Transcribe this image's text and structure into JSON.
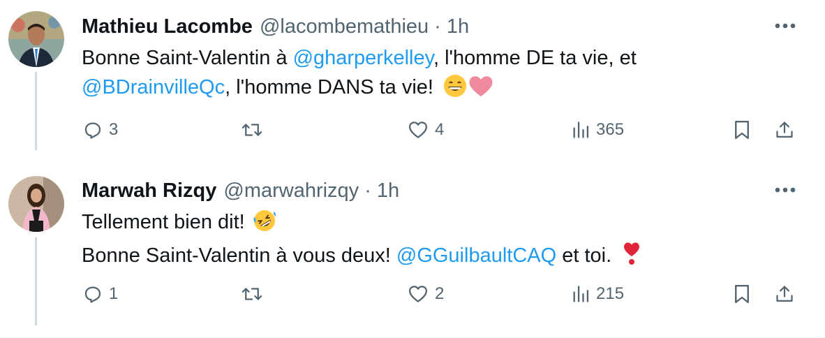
{
  "tweets": [
    {
      "name": "Mathieu Lacombe",
      "handle": "@lacombemathieu",
      "separator": "·",
      "time": "1h",
      "text_1a": "Bonne Saint-Valentin à ",
      "mention_1": "@gharperkelley",
      "text_1b": ", l'homme DE ta vie, et",
      "mention_2": "@BDrainvilleQc",
      "text_2b": ", l'homme DANS ta vie!",
      "emojis": [
        "grinning-face",
        "pink-heart"
      ],
      "replies": "3",
      "retweets": "",
      "likes": "4",
      "views": "365"
    },
    {
      "name": "Marwah Rizqy",
      "handle": "@marwahrizqy",
      "separator": "·",
      "time": "1h",
      "text_1a": "Tellement bien dit!",
      "text_2a": "Bonne Saint-Valentin à vous deux! ",
      "mention_1": "@GGuilbaultCAQ",
      "text_2b": " et toi.",
      "emojis": [
        "rolling-on-floor-laughing",
        "heart-exclamation"
      ],
      "replies": "1",
      "retweets": "",
      "likes": "2",
      "views": "215"
    }
  ],
  "colors": {
    "link": "#1d9bf0",
    "secondary_text": "#536471",
    "thread_line": "#cfd9de"
  }
}
